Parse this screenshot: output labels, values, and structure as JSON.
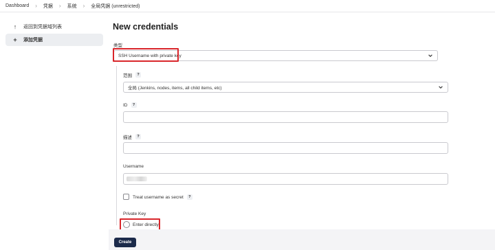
{
  "breadcrumb": {
    "items": [
      "Dashboard",
      "凭据",
      "系统",
      "全局凭据 (unrestricted)"
    ]
  },
  "sidebar": {
    "back_label": "返回到凭据域列表",
    "add_label": "添加凭据"
  },
  "page": {
    "title": "New credentials"
  },
  "form": {
    "kind_label": "类型",
    "kind_value": "SSH Username with private key",
    "scope_label": "范围",
    "scope_value": "全局 (Jenkins, nodes, items, all child items, etc)",
    "id_label": "ID",
    "id_value": "",
    "description_label": "描述",
    "description_value": "",
    "username_label": "Username",
    "treat_secret_label": "Treat username as secret",
    "treat_secret_checked": false,
    "private_key_label": "Private Key",
    "enter_directly_label": "Enter directly",
    "help_glyph": "?",
    "create_label": "Create"
  },
  "colors": {
    "highlight": "#d9252a",
    "button": "#1b2a4a"
  },
  "icons": {
    "back": "arrow-up-icon",
    "add": "plus-icon",
    "dropdown": "chevron-down-icon",
    "separator": "chevron-right-icon"
  }
}
